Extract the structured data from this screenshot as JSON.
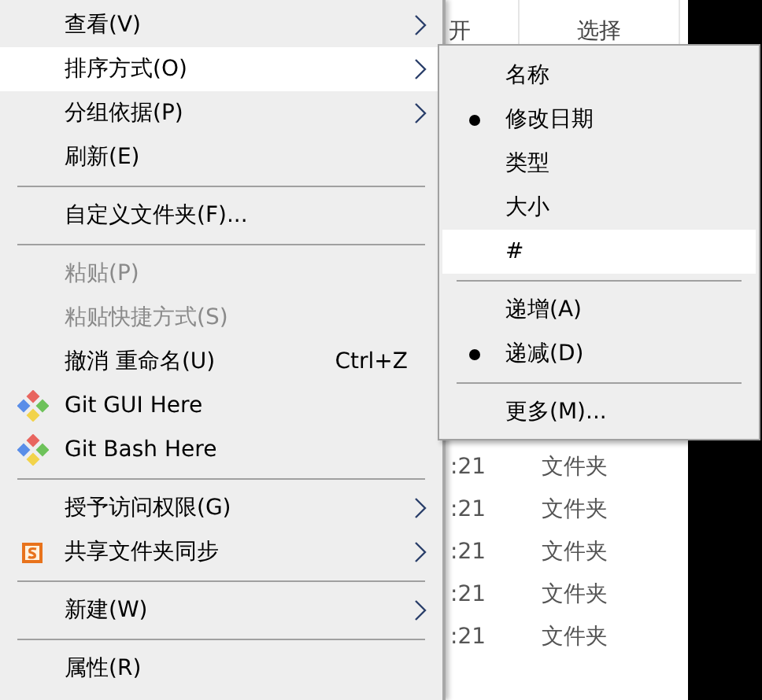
{
  "file_list": {
    "columns": [
      "开",
      "选择"
    ],
    "rows": [
      {
        "time": ":21",
        "type": "文件夹"
      },
      {
        "time": ":21",
        "type": "文件夹"
      },
      {
        "time": ":21",
        "type": "文件夹"
      },
      {
        "time": ":21",
        "type": "文件夹"
      },
      {
        "time": ":21",
        "type": "文件夹"
      }
    ]
  },
  "context_menu": {
    "items": [
      {
        "kind": "item",
        "label": "查看(V)",
        "submenu": true,
        "disabled": false,
        "selected": false
      },
      {
        "kind": "item",
        "label": "排序方式(O)",
        "submenu": true,
        "disabled": false,
        "selected": true
      },
      {
        "kind": "item",
        "label": "分组依据(P)",
        "submenu": true,
        "disabled": false,
        "selected": false
      },
      {
        "kind": "item",
        "label": "刷新(E)",
        "submenu": false,
        "disabled": false,
        "selected": false
      },
      {
        "kind": "separator"
      },
      {
        "kind": "item",
        "label": "自定义文件夹(F)...",
        "submenu": false,
        "disabled": false,
        "selected": false
      },
      {
        "kind": "separator"
      },
      {
        "kind": "item",
        "label": "粘贴(P)",
        "submenu": false,
        "disabled": true,
        "selected": false
      },
      {
        "kind": "item",
        "label": "粘贴快捷方式(S)",
        "submenu": false,
        "disabled": true,
        "selected": false
      },
      {
        "kind": "item",
        "label": "撤消 重命名(U)",
        "shortcut": "Ctrl+Z",
        "submenu": false,
        "disabled": false,
        "selected": false
      },
      {
        "kind": "git",
        "label": "Git GUI Here",
        "submenu": false,
        "disabled": false,
        "selected": false
      },
      {
        "kind": "git",
        "label": "Git Bash Here",
        "submenu": false,
        "disabled": false,
        "selected": false
      },
      {
        "kind": "separator"
      },
      {
        "kind": "item",
        "label": "授予访问权限(G)",
        "submenu": true,
        "disabled": false,
        "selected": false
      },
      {
        "kind": "sync",
        "label": "共享文件夹同步",
        "submenu": true,
        "disabled": false,
        "selected": false
      },
      {
        "kind": "separator"
      },
      {
        "kind": "item",
        "label": "新建(W)",
        "submenu": true,
        "disabled": false,
        "selected": false
      },
      {
        "kind": "separator"
      },
      {
        "kind": "item",
        "label": "属性(R)",
        "submenu": false,
        "disabled": false,
        "selected": false
      }
    ]
  },
  "sort_submenu": {
    "items": [
      {
        "kind": "item",
        "label": "名称",
        "checked": false,
        "selected": false
      },
      {
        "kind": "item",
        "label": "修改日期",
        "checked": true,
        "selected": false
      },
      {
        "kind": "item",
        "label": "类型",
        "checked": false,
        "selected": false
      },
      {
        "kind": "item",
        "label": "大小",
        "checked": false,
        "selected": false
      },
      {
        "kind": "item",
        "label": "#",
        "checked": false,
        "selected": true
      },
      {
        "kind": "separator"
      },
      {
        "kind": "item",
        "label": "递增(A)",
        "checked": false,
        "selected": false
      },
      {
        "kind": "item",
        "label": "递减(D)",
        "checked": true,
        "selected": false
      },
      {
        "kind": "separator"
      },
      {
        "kind": "item",
        "label": "更多(M)...",
        "checked": false,
        "selected": false
      }
    ]
  }
}
